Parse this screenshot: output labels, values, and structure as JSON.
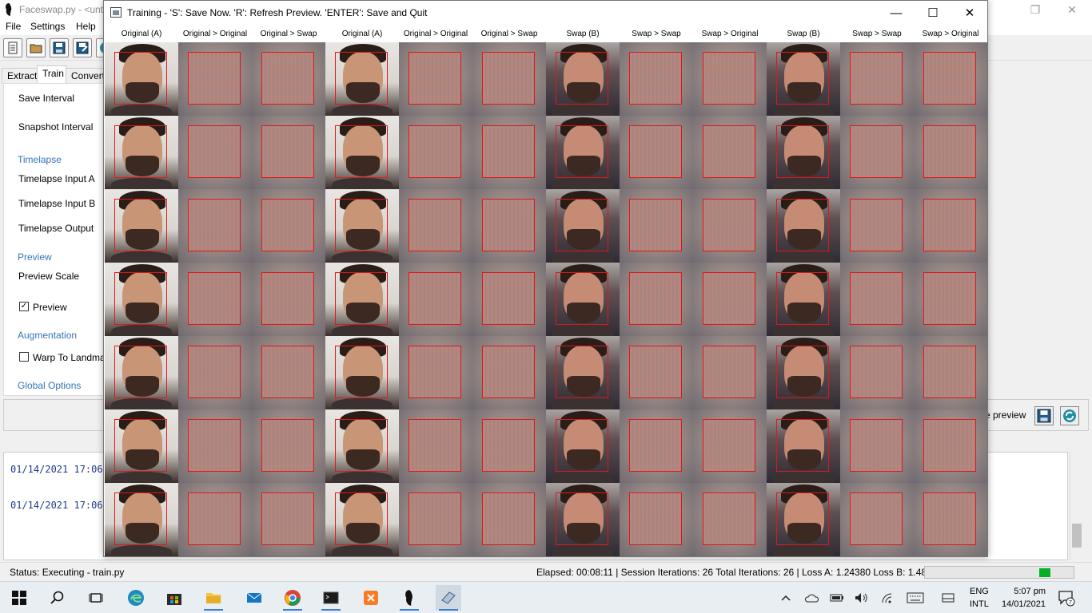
{
  "app": {
    "title": "Faceswap.py - <unt",
    "menu": [
      "File",
      "Settings",
      "Help"
    ],
    "tabs": [
      "Extract",
      "Train",
      "Convert"
    ]
  },
  "options": {
    "save_interval": "Save Interval",
    "snapshot_interval": "Snapshot Interval",
    "timelapse_head": "Timelapse",
    "timelapse_input_a": "Timelapse Input A",
    "timelapse_input_b": "Timelapse Input B",
    "timelapse_output": "Timelapse Output",
    "preview_head": "Preview",
    "preview_scale": "Preview Scale",
    "preview_checkbox": "Preview",
    "augmentation_head": "Augmentation",
    "warp_checkbox": "Warp To Landma",
    "global_options": "Global Options"
  },
  "bottom": {
    "preview_label": "e preview"
  },
  "console": {
    "lines": [
      "01/14/2021 17:06:",
      "01/14/2021 17:06:"
    ]
  },
  "status": {
    "left": "Status:  Executing - train.py",
    "right": "Elapsed: 00:08:11 | Session Iterations: 26  Total Iterations: 26 | Loss A: 1.24380  Loss B: 1.48092",
    "progress_fraction": 0.08
  },
  "training": {
    "title": "Training - 'S': Save Now. 'R': Refresh Preview. 'ENTER': Save and Quit",
    "columns": [
      "Original (A)",
      "Original > Original",
      "Original > Swap",
      "Original (A)",
      "Original > Original",
      "Original > Swap",
      "Swap (B)",
      "Swap > Swap",
      "Swap > Original",
      "Swap (B)",
      "Swap > Swap",
      "Swap > Original"
    ],
    "rows": 7
  },
  "taskbar": {
    "lang_top": "ENG",
    "lang_bottom": "INTL",
    "time": "5:07 pm",
    "date": "14/01/2021",
    "notification_count": "7"
  },
  "colors": {
    "accent_blue": "#3475b5",
    "progress_green": "#06b025",
    "face_box_red": "#e01818"
  }
}
